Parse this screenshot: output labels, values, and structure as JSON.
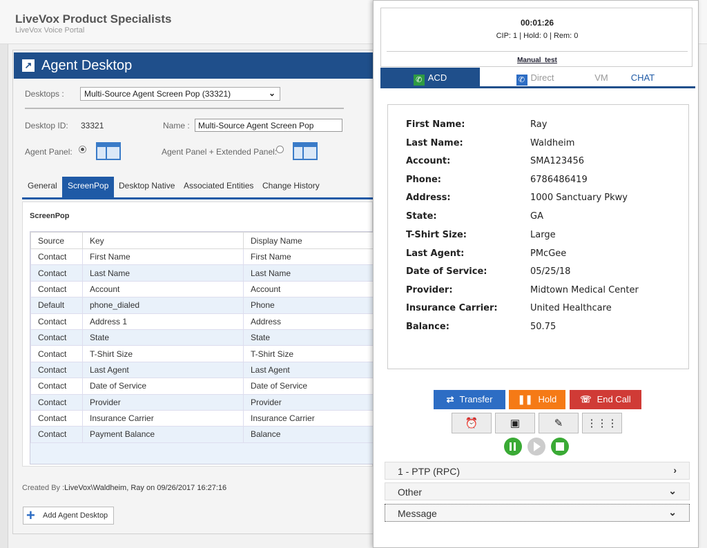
{
  "portal": {
    "title": "LiveVox Product Specialists",
    "subtitle": "LiveVox Voice Portal"
  },
  "agent_desktop": {
    "title": "Agent Desktop",
    "desktops_label": "Desktops :",
    "desktops_value": "Multi-Source Agent Screen Pop (33321)",
    "desktop_id_label": "Desktop ID:",
    "desktop_id_value": "33321",
    "name_label": "Name :",
    "name_value": "Multi-Source Agent Screen Pop",
    "agent_panel_label": "Agent Panel:",
    "extended_panel_label": "Agent Panel + Extended Panel:",
    "tabs": [
      "General",
      "ScreenPop",
      "Desktop Native",
      "Associated Entities",
      "Change History"
    ],
    "active_tab": "ScreenPop",
    "screenpop_title": "ScreenPop",
    "table": {
      "headers": [
        "Source",
        "Key",
        "Display Name"
      ],
      "rows": [
        [
          "Contact",
          "First Name",
          "First Name"
        ],
        [
          "Contact",
          "Last Name",
          "Last Name"
        ],
        [
          "Contact",
          "Account",
          "Account"
        ],
        [
          "Default",
          "phone_dialed",
          "Phone"
        ],
        [
          "Contact",
          "Address 1",
          "Address"
        ],
        [
          "Contact",
          "State",
          "State"
        ],
        [
          "Contact",
          "T-Shirt Size",
          "T-Shirt Size"
        ],
        [
          "Contact",
          "Last Agent",
          "Last Agent"
        ],
        [
          "Contact",
          "Date of Service",
          "Date of Service"
        ],
        [
          "Contact",
          "Provider",
          "Provider"
        ],
        [
          "Contact",
          "Insurance Carrier",
          "Insurance Carrier"
        ],
        [
          "Contact",
          "Payment Balance",
          "Balance"
        ]
      ]
    },
    "created_by_label": "Created By :",
    "created_by_value": "LiveVox\\Waldheim, Ray on 09/26/2017 16:27:16",
    "add_button": "Add Agent Desktop"
  },
  "agent_panel": {
    "timer": "00:01:26",
    "call_status": "CIP: 1 | Hold: 0 | Rem: 0",
    "campaign": "Manual_test",
    "tabs": {
      "acd": "ACD",
      "direct": "Direct",
      "vm": "VM",
      "chat": "CHAT"
    },
    "details": [
      {
        "key": "First Name:",
        "value": "Ray"
      },
      {
        "key": "Last Name:",
        "value": "Waldheim"
      },
      {
        "key": "Account:",
        "value": "SMA123456"
      },
      {
        "key": "Phone:",
        "value": "6786486419"
      },
      {
        "key": "Address:",
        "value": "1000 Sanctuary Pkwy"
      },
      {
        "key": "State:",
        "value": "GA"
      },
      {
        "key": "T-Shirt Size:",
        "value": "Large"
      },
      {
        "key": "Last Agent:",
        "value": "PMcGee"
      },
      {
        "key": "Date of Service:",
        "value": "05/25/18"
      },
      {
        "key": "Provider:",
        "value": "Midtown Medical Center"
      },
      {
        "key": "Insurance Carrier:",
        "value": "United Healthcare"
      },
      {
        "key": "Balance:",
        "value": "50.75"
      }
    ],
    "buttons": {
      "transfer": "Transfer",
      "hold": "Hold",
      "end_call": "End Call"
    },
    "accordion": {
      "item1": "1 - PTP (RPC)",
      "item2": "Other",
      "item3": "Message"
    },
    "colors": {
      "header_blue": "#1f4f8b",
      "transfer": "#2d6dc4",
      "hold": "#f57a16",
      "end_call": "#d03b36",
      "record_green": "#3aaa35"
    }
  }
}
